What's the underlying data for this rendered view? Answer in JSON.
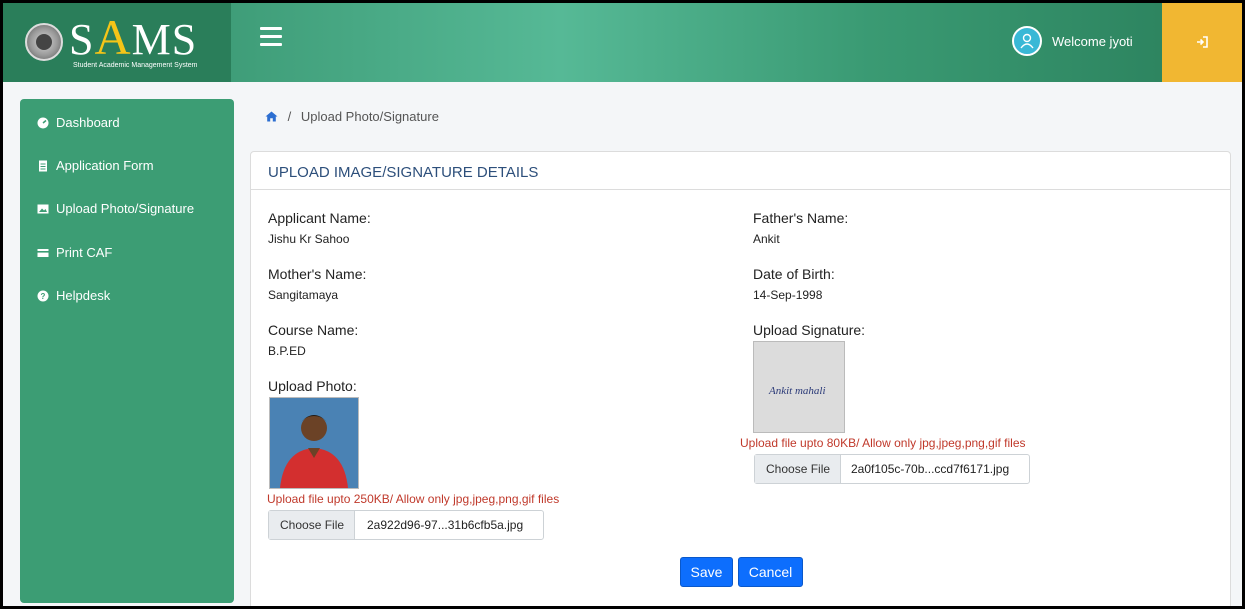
{
  "header": {
    "brand": {
      "s": "S",
      "a": "A",
      "ms": "MS"
    },
    "brand_subtitle": "Student Academic Management System",
    "welcome": "Welcome jyoti"
  },
  "sidebar": {
    "items": [
      {
        "label": "Dashboard",
        "icon": "dashboard-icon"
      },
      {
        "label": "Application Form",
        "icon": "file-icon"
      },
      {
        "label": "Upload Photo/Signature",
        "icon": "image-icon"
      },
      {
        "label": "Print CAF",
        "icon": "card-icon"
      },
      {
        "label": "Helpdesk",
        "icon": "question-icon"
      }
    ]
  },
  "breadcrumb": {
    "separator": "/",
    "current": "Upload Photo/Signature"
  },
  "card": {
    "title": "UPLOAD IMAGE/SIGNATURE DETAILS",
    "applicant_label": "Applicant Name:",
    "applicant_value": "Jishu Kr Sahoo",
    "father_label": "Father's Name:",
    "father_value": "Ankit",
    "mother_label": "Mother's Name:",
    "mother_value": "Sangitamaya",
    "dob_label": "Date of Birth:",
    "dob_value": "14-Sep-1998",
    "course_label": "Course Name:",
    "course_value": "B.P.ED",
    "signature_label": "Upload Signature:",
    "signature_text": "Ankit mahali",
    "signature_note": "Upload file upto 80KB/ Allow only jpg,jpeg,png,gif files",
    "signature_file_button": "Choose File",
    "signature_file_name": "2a0f105c-70b...ccd7f6171.jpg",
    "photo_label": "Upload Photo:",
    "photo_note": "Upload file upto 250KB/ Allow only jpg,jpeg,png,gif files",
    "photo_file_button": "Choose File",
    "photo_file_name": "2a922d96-97...31b6cfb5a.jpg",
    "save_label": "Save",
    "cancel_label": "Cancel"
  },
  "colors": {
    "header_green": "#56b996",
    "sidebar_green": "#3c9d74",
    "logout_yellow": "#f1b732",
    "primary_blue": "#0d6efd",
    "warning_red": "#c0392b",
    "title_blue": "#2d4f7b"
  }
}
